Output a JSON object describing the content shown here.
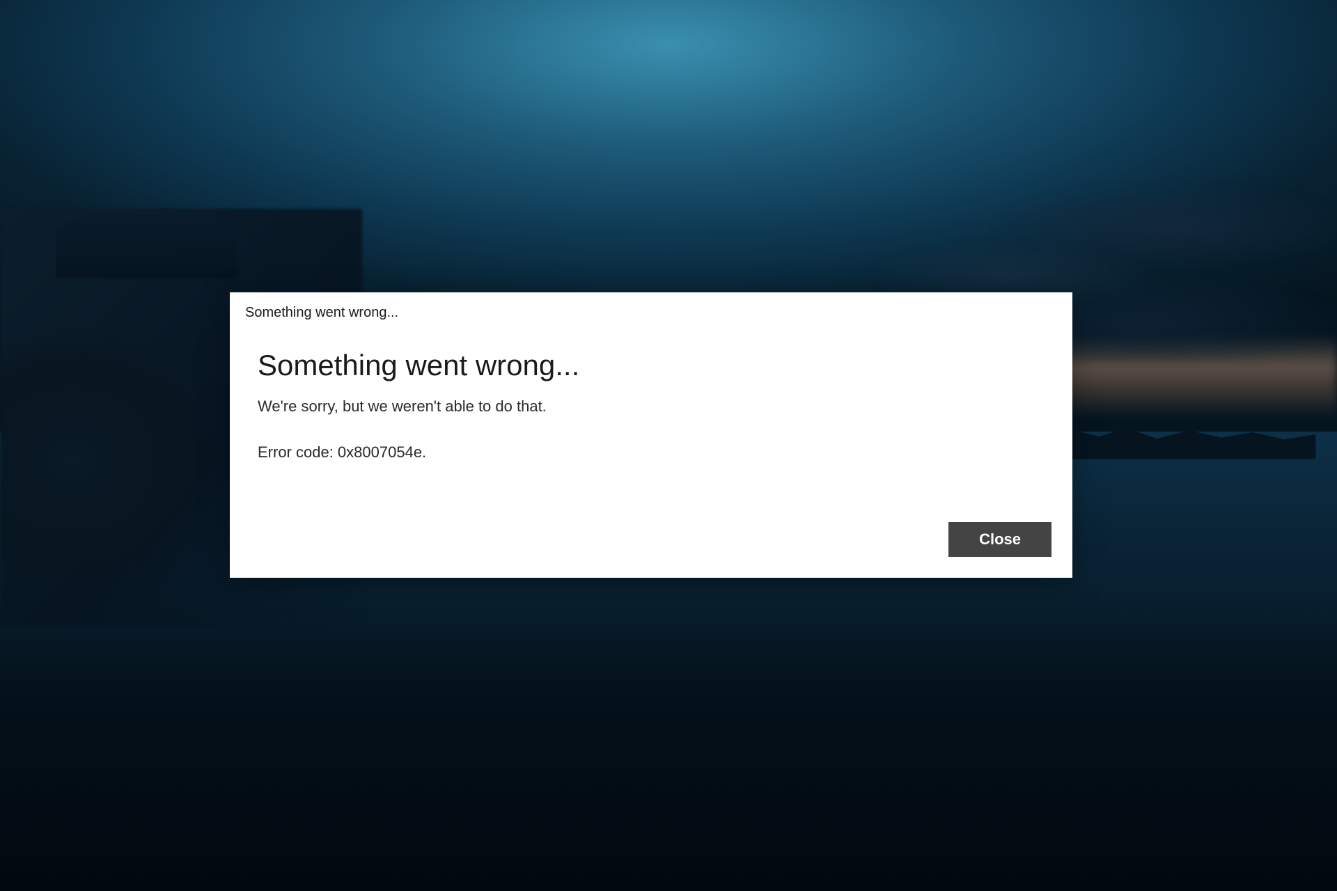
{
  "dialog": {
    "window_title": "Something went wrong...",
    "heading": "Something went wrong...",
    "message": "We're sorry, but we weren't able to do that.",
    "error_code_line": "Error code: 0x8007054e.",
    "close_label": "Close"
  }
}
